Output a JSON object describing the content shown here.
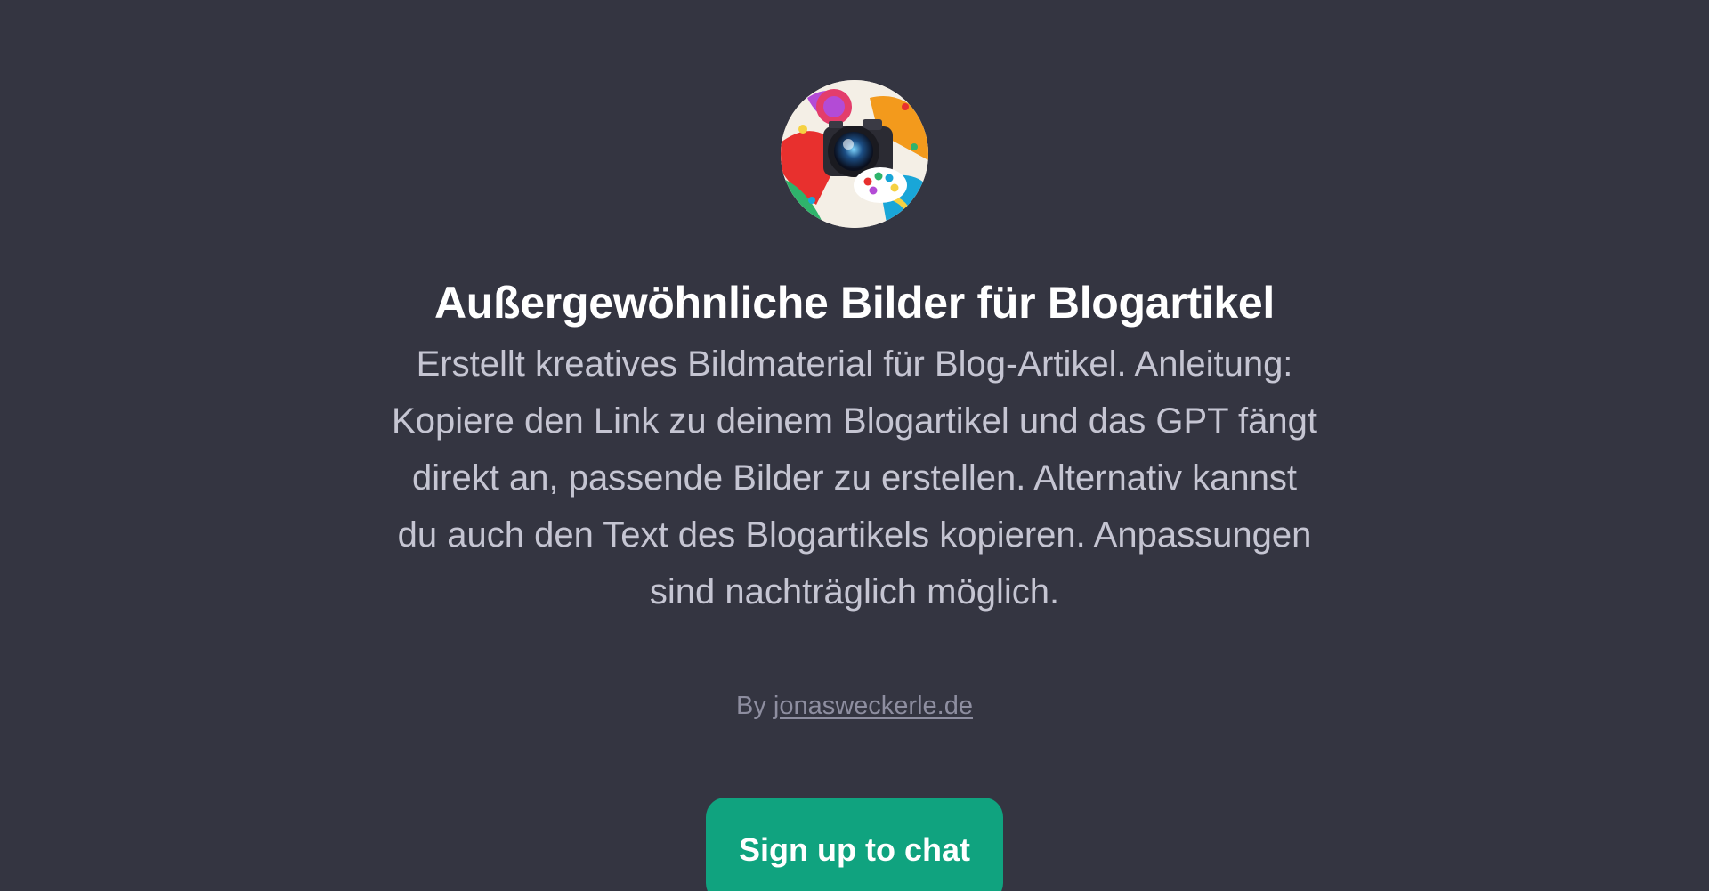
{
  "gpt": {
    "icon": "camera-palette-artwork",
    "title": "Außergewöhnliche Bilder für Blogartikel",
    "description": "Erstellt kreatives Bildmaterial für Blog-Artikel. Anleitung: Kopiere den Link zu deinem Blogartikel und das GPT fängt direkt an, passende Bilder zu erstellen. Alternativ kannst du auch den Text des Blogartikels kopieren. Anpassungen sind nachträglich möglich.",
    "byline_prefix": "By",
    "author_link": "jonasweckerle.de"
  },
  "cta": {
    "label": "Sign up to chat"
  },
  "colors": {
    "background": "#343541",
    "title": "#ffffff",
    "description": "#c5c5d2",
    "byline": "#8e8ea0",
    "accent": "#10a37f"
  }
}
